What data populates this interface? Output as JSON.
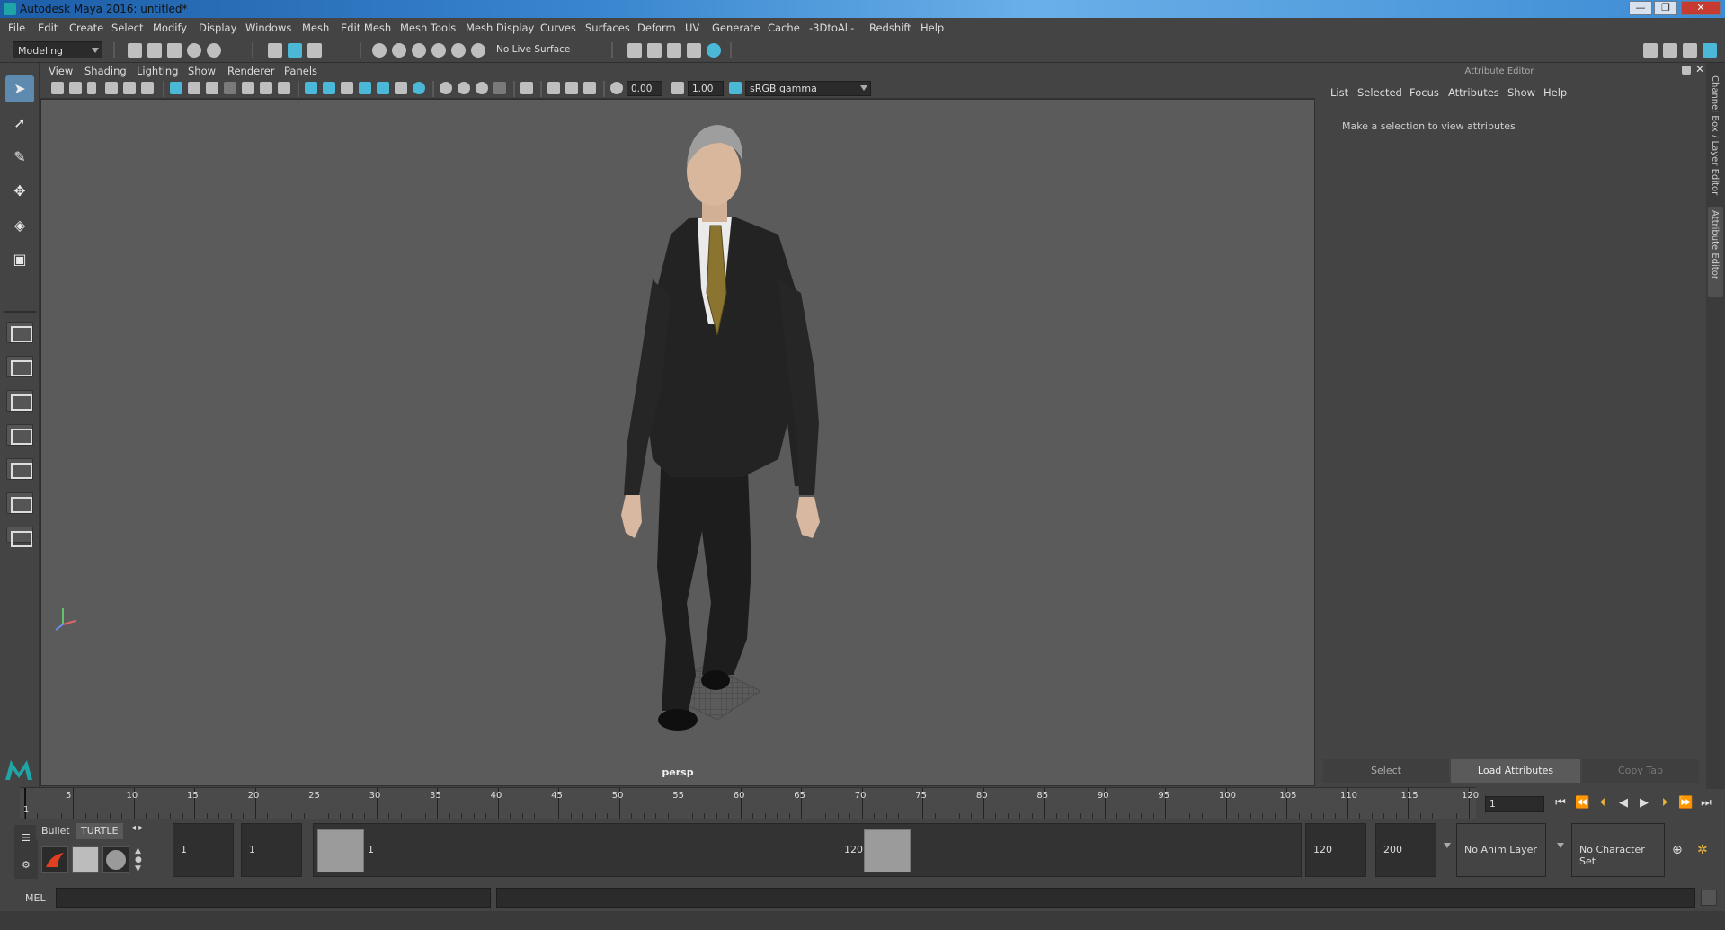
{
  "window": {
    "title": "Autodesk Maya 2016: untitled*",
    "minimize": "—",
    "restore": "❐",
    "close": "✕"
  },
  "menubar": [
    "File",
    "Edit",
    "Create",
    "Select",
    "Modify",
    "Display",
    "Windows",
    "Mesh",
    "Edit Mesh",
    "Mesh Tools",
    "Mesh Display",
    "Curves",
    "Surfaces",
    "Deform",
    "UV",
    "Generate",
    "Cache",
    "-3DtoAll-",
    "Redshift",
    "Help"
  ],
  "shelf": {
    "mode": "Modeling",
    "live_surface": "No Live Surface"
  },
  "viewport": {
    "menu": [
      "View",
      "Shading",
      "Lighting",
      "Show",
      "Renderer",
      "Panels"
    ],
    "exposure": "0.00",
    "gamma": "1.00",
    "color_space": "sRGB gamma",
    "camera": "persp"
  },
  "attribute_editor": {
    "title": "Attribute Editor",
    "menu": [
      "List",
      "Selected",
      "Focus",
      "Attributes",
      "Show",
      "Help"
    ],
    "message": "Make a selection to view attributes",
    "buttons": {
      "select": "Select",
      "load": "Load Attributes",
      "copy": "Copy Tab"
    }
  },
  "side_tabs": {
    "channel_box": "Channel Box / Layer Editor",
    "attribute_editor": "Attribute Editor"
  },
  "timeline": {
    "start_label": "1",
    "ticks": [
      "5",
      "10",
      "15",
      "20",
      "25",
      "30",
      "35",
      "40",
      "45",
      "50",
      "55",
      "60",
      "65",
      "70",
      "75",
      "80",
      "85",
      "90",
      "95",
      "100",
      "105",
      "110",
      "115",
      "120"
    ],
    "current_frame": "1"
  },
  "range": {
    "shelf_tabs": [
      "Bullet",
      "TURTLE"
    ],
    "start": "1",
    "playback_start": "1",
    "handle_start": "1",
    "handle_end": "120",
    "playback_end": "120",
    "end": "200",
    "anim_layer": "No Anim Layer",
    "character_set": "No Character Set"
  },
  "command_line": {
    "label": "MEL"
  }
}
